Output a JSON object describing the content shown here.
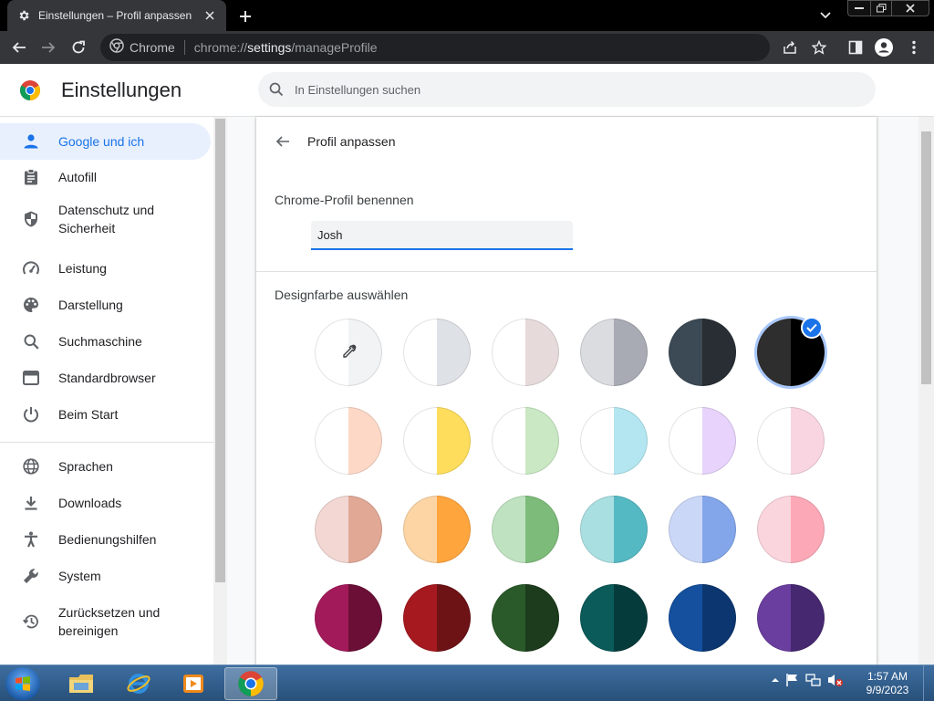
{
  "window": {
    "tab_title": "Einstellungen – Profil anpassen",
    "icons": {
      "tab": "gear-icon",
      "close": "close-icon",
      "new_tab": "plus-icon",
      "tab_search": "chevron-down-icon",
      "minimize": "minimize-icon",
      "maximize": "maximize-icon",
      "close_window": "close-icon"
    }
  },
  "toolbar": {
    "site_chip": "Chrome",
    "url_scheme": "chrome://",
    "url_host": "settings",
    "url_path": "/manageProfile",
    "icons": [
      "back-icon",
      "forward-icon",
      "reload-icon",
      "share-icon",
      "bookmark-star-icon",
      "side-panel-icon",
      "profile-icon",
      "kebab-menu-icon"
    ]
  },
  "header": {
    "title": "Einstellungen",
    "search_placeholder": "In Einstellungen suchen"
  },
  "sidebar": {
    "items": [
      {
        "label": "Google und ich",
        "icon": "person-icon",
        "active": true
      },
      {
        "label": "Autofill",
        "icon": "clipboard-icon"
      },
      {
        "label": "Datenschutz und Sicherheit",
        "icon": "shield-icon"
      },
      {
        "label": "Leistung",
        "icon": "speedometer-icon"
      },
      {
        "label": "Darstellung",
        "icon": "palette-icon"
      },
      {
        "label": "Suchmaschine",
        "icon": "search-icon"
      },
      {
        "label": "Standardbrowser",
        "icon": "browser-window-icon"
      },
      {
        "label": "Beim Start",
        "icon": "power-icon"
      },
      {
        "label": "Sprachen",
        "icon": "globe-icon"
      },
      {
        "label": "Downloads",
        "icon": "download-icon"
      },
      {
        "label": "Bedienungshilfen",
        "icon": "accessibility-icon"
      },
      {
        "label": "System",
        "icon": "wrench-icon"
      },
      {
        "label": "Zurücksetzen und bereinigen",
        "icon": "history-icon"
      }
    ]
  },
  "main": {
    "title": "Profil anpassen",
    "name_section_label": "Chrome-Profil benennen",
    "profile_name": "Josh",
    "color_section_label": "Designfarbe auswählen",
    "selected_swatch": 5,
    "swatches": [
      {
        "left": "#ffffff",
        "right": "#f1f3f4",
        "icon": "eyedropper-icon"
      },
      {
        "left": "#ffffff",
        "right": "#dee1e6"
      },
      {
        "left": "#ffffff",
        "right": "#e6dbda"
      },
      {
        "left": "#dadce0",
        "right": "#a8abb4"
      },
      {
        "left": "#3c4a55",
        "right": "#282e33"
      },
      {
        "left": "#2e2e2e",
        "right": "#000000"
      },
      {
        "left": "#ffffff",
        "right": "#fdd8c6"
      },
      {
        "left": "#ffffff",
        "right": "#fddd5b"
      },
      {
        "left": "#ffffff",
        "right": "#c9e8c3"
      },
      {
        "left": "#ffffff",
        "right": "#b3e6f0"
      },
      {
        "left": "#ffffff",
        "right": "#e7d3fb"
      },
      {
        "left": "#ffffff",
        "right": "#f8d5e1"
      },
      {
        "left": "#f2d7d3",
        "right": "#e2a896"
      },
      {
        "left": "#fdd5a5",
        "right": "#fea53e"
      },
      {
        "left": "#bfe3c1",
        "right": "#7dbb7a"
      },
      {
        "left": "#aadfe1",
        "right": "#55b9c4"
      },
      {
        "left": "#cad7f6",
        "right": "#83a6ea"
      },
      {
        "left": "#fbd5dd",
        "right": "#fca8b7"
      },
      {
        "left": "#a31a5b",
        "right": "#6b0f36"
      },
      {
        "left": "#a5191f",
        "right": "#6d1215"
      },
      {
        "left": "#2a5a2a",
        "right": "#1d3b1d"
      },
      {
        "left": "#0b5b5b",
        "right": "#063b3b"
      },
      {
        "left": "#14509e",
        "right": "#0c3670"
      },
      {
        "left": "#6a3e9e",
        "right": "#462870"
      }
    ]
  },
  "taskbar": {
    "time": "1:57 AM",
    "date": "9/9/2023",
    "apps": [
      "file-explorer-icon",
      "internet-explorer-icon",
      "media-player-icon",
      "chrome-icon"
    ]
  }
}
